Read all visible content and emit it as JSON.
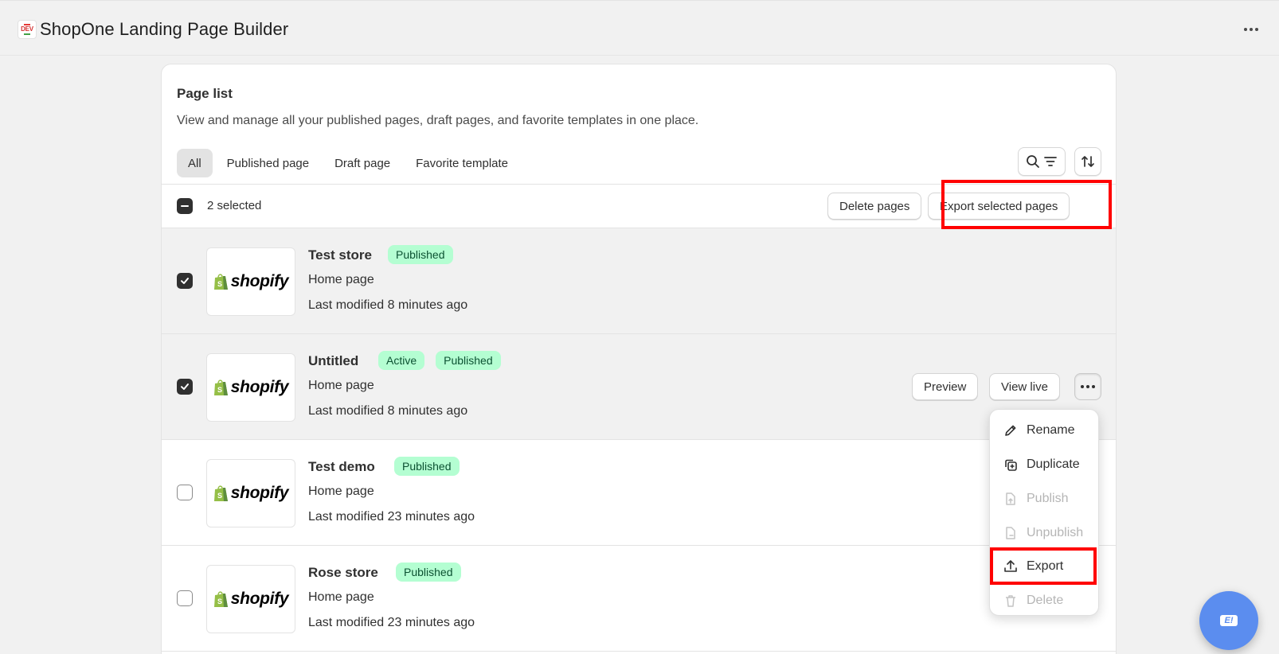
{
  "app": {
    "title": "ShopOne Landing Page Builder",
    "logo_text": "DEV"
  },
  "card": {
    "title": "Page list",
    "description": "View and manage all your published pages, draft pages, and favorite templates in one place."
  },
  "tabs": [
    {
      "label": "All",
      "active": true
    },
    {
      "label": "Published page",
      "active": false
    },
    {
      "label": "Draft page",
      "active": false
    },
    {
      "label": "Favorite template",
      "active": false
    }
  ],
  "bulk": {
    "selected_text": "2 selected",
    "delete_label": "Delete pages",
    "export_label": "Export selected pages"
  },
  "pages": [
    {
      "name": "Test store",
      "badges": [
        "Published"
      ],
      "type": "Home page",
      "modified": "Last modified 8 minutes ago",
      "checked": true,
      "thumb_text": "shopify"
    },
    {
      "name": "Untitled",
      "badges": [
        "Active",
        "Published"
      ],
      "type": "Home page",
      "modified": "Last modified 8 minutes ago",
      "checked": true,
      "thumb_text": "shopify"
    },
    {
      "name": "Test demo",
      "badges": [
        "Published"
      ],
      "type": "Home page",
      "modified": "Last modified 23 minutes ago",
      "checked": false,
      "thumb_text": "shopify"
    },
    {
      "name": "Rose store",
      "badges": [
        "Published"
      ],
      "type": "Home page",
      "modified": "Last modified 23 minutes ago",
      "checked": false,
      "thumb_text": "shopify"
    }
  ],
  "row_actions": {
    "preview_label": "Preview",
    "view_live_label": "View live"
  },
  "menu": {
    "items": [
      {
        "label": "Rename",
        "icon": "pencil-icon",
        "disabled": false
      },
      {
        "label": "Duplicate",
        "icon": "duplicate-icon",
        "disabled": false
      },
      {
        "label": "Publish",
        "icon": "file-upload-icon",
        "disabled": true
      },
      {
        "label": "Unpublish",
        "icon": "file-minus-icon",
        "disabled": true
      },
      {
        "label": "Export",
        "icon": "export-icon",
        "disabled": false
      },
      {
        "label": "Delete",
        "icon": "trash-icon",
        "disabled": true
      }
    ]
  },
  "colors": {
    "badge_bg": "#b4fed2",
    "badge_text": "#0c5132",
    "highlight": "#ff0000",
    "fab": "#5b8def",
    "shopify_green": "#95bf47"
  },
  "fab": {
    "label": "E!"
  }
}
